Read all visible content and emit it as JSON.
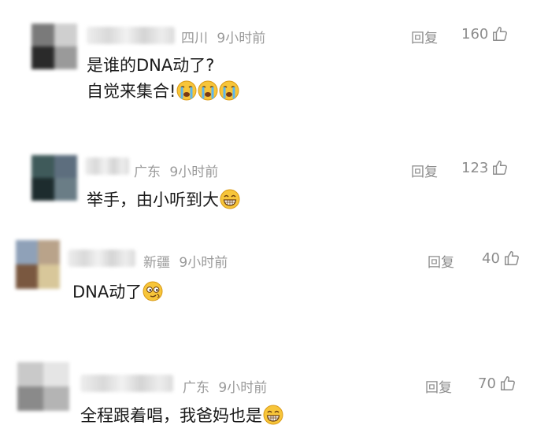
{
  "comments": [
    {
      "region": "四川",
      "time": "9小时前",
      "reply_label": "回复",
      "likes": "160",
      "text_lines": [
        "是谁的DNA动了?",
        "自觉来集合!"
      ],
      "emojis": [
        "crying-face-icon",
        "crying-face-icon",
        "crying-face-icon"
      ]
    },
    {
      "region": "广东",
      "time": "9小时前",
      "reply_label": "回复",
      "likes": "123",
      "text_lines": [
        "举手，由小听到大"
      ],
      "emojis": [
        "grinning-face-icon"
      ]
    },
    {
      "region": "新疆",
      "time": "9小时前",
      "reply_label": "回复",
      "likes": "40",
      "text_lines": [
        "DNA动了"
      ],
      "emojis": [
        "smirk-face-icon"
      ]
    },
    {
      "region": "广东",
      "time": "9小时前",
      "reply_label": "回复",
      "likes": "70",
      "text_lines": [
        "全程跟着唱，我爸妈也是"
      ],
      "emojis": [
        "grinning-face-icon"
      ]
    }
  ],
  "colors": {
    "meta_text": "#9a9a9a",
    "body_text": "#1a1a1a",
    "emoji_yellow": "#f7c53a"
  }
}
